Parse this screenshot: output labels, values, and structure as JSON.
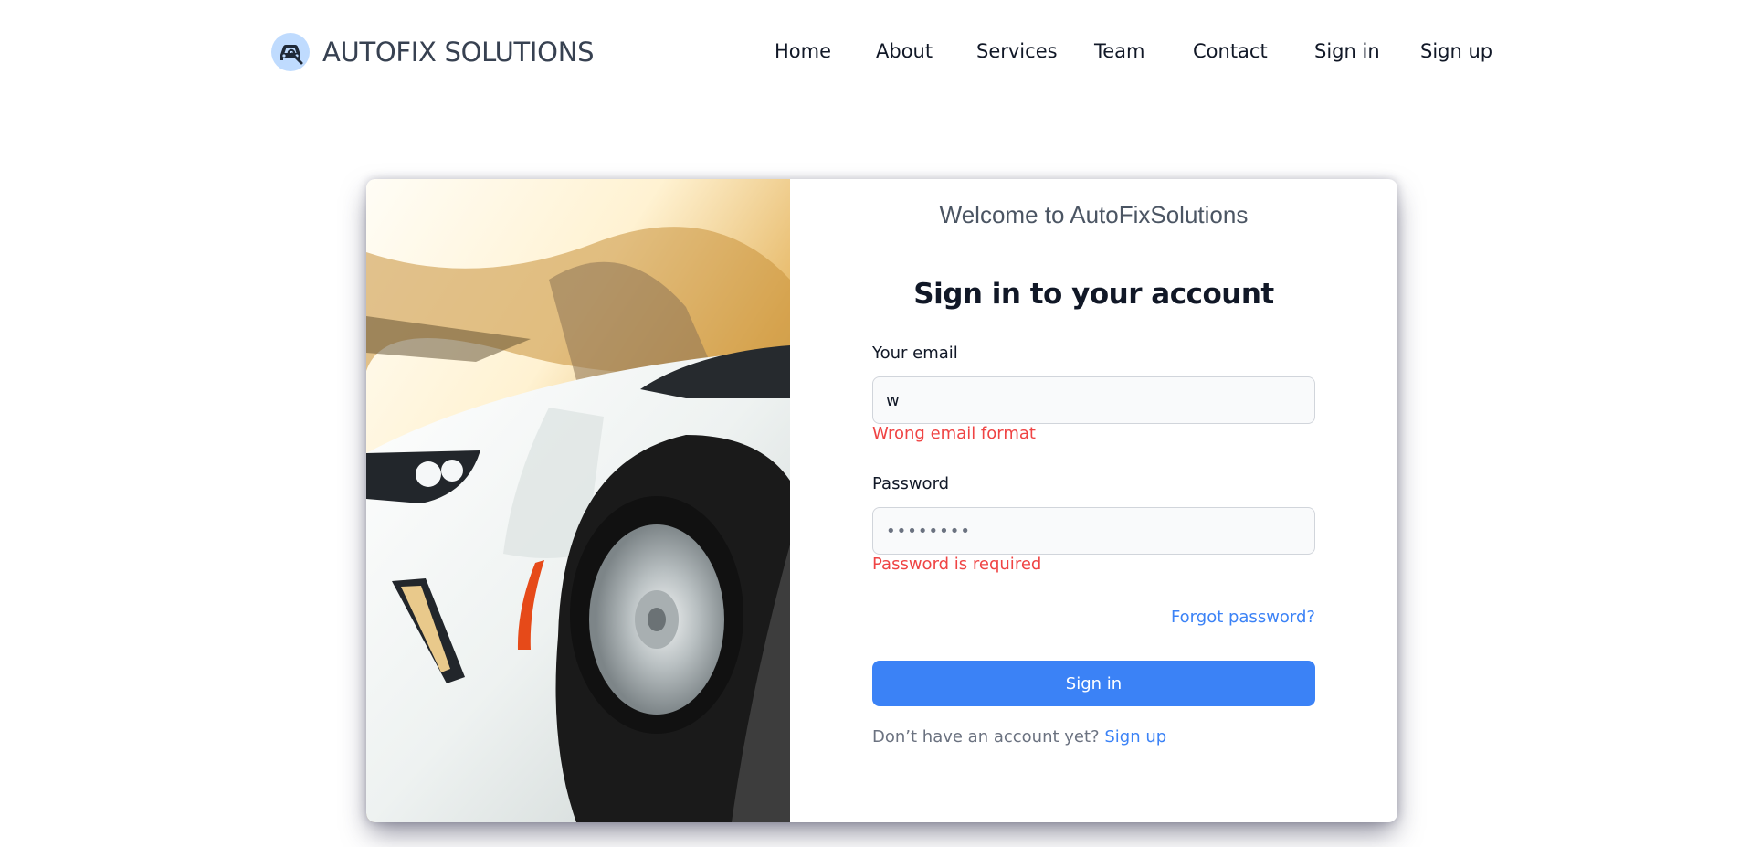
{
  "brand": {
    "name": "AUTOFIX SOLUTIONS",
    "icon": "car-wrench-icon",
    "icon_bg": "#bfdbfe"
  },
  "nav": {
    "items": [
      {
        "label": "Home"
      },
      {
        "label": "About"
      },
      {
        "label": "Services"
      },
      {
        "label": "Team"
      },
      {
        "label": "Contact"
      },
      {
        "label": "Sign in"
      },
      {
        "label": "Sign up"
      }
    ]
  },
  "hero": {
    "image": "white-sports-car-photo"
  },
  "login": {
    "welcome": "Welcome to AutoFixSolutions",
    "title": "Sign in to your account",
    "email_label": "Your email",
    "email_value": "w",
    "email_error": "Wrong email format",
    "password_label": "Password",
    "password_value": "••••••••",
    "password_error": "Password is required",
    "forgot": "Forgot password?",
    "submit": "Sign in",
    "no_account": "Don’t have an account yet?",
    "signup_link": "Sign up"
  },
  "colors": {
    "accent": "#3b82f6",
    "error": "#ef4444",
    "text": "#111827",
    "muted": "#6b7280"
  }
}
